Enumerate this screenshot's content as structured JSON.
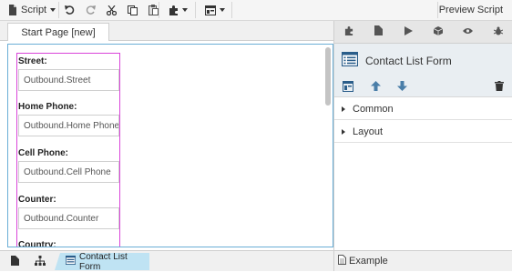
{
  "toolbar": {
    "script_label": "Script",
    "preview_label": "Preview Script"
  },
  "tabs": [
    {
      "label": "Start Page [new]"
    }
  ],
  "form": {
    "fields": [
      {
        "label": "Street:",
        "value": "Outbound.Street"
      },
      {
        "label": "Home Phone:",
        "value": "Outbound.Home Phone"
      },
      {
        "label": "Cell Phone:",
        "value": "Outbound.Cell Phone"
      },
      {
        "label": "Counter:",
        "value": "Outbound.Counter"
      },
      {
        "label": "Country:",
        "value": ""
      }
    ]
  },
  "right_panel": {
    "title": "Contact List Form",
    "sections": [
      {
        "label": "Common"
      },
      {
        "label": "Layout"
      }
    ]
  },
  "breadcrumb": {
    "current": "Contact List Form"
  },
  "bottom_right": {
    "label": "Example"
  },
  "colors": {
    "canvas_border": "#6aaed6",
    "form_outline": "#d944d9",
    "breadcrumb_bg": "#bfe3f3",
    "accent_blue": "#2a5d8a",
    "panel_header_bg": "#e9eef2"
  },
  "icons": {
    "toolbar": [
      "script-icon",
      "undo-icon",
      "redo-icon",
      "cut-icon",
      "copy-icon",
      "paste-icon",
      "puzzle-icon",
      "layout-icon"
    ],
    "right_panel_tabs": [
      "puzzle-icon",
      "page-icon",
      "play-icon",
      "cube-icon",
      "eye-icon",
      "bug-icon"
    ],
    "right_panel_actions": [
      "form-icon",
      "arrow-up-icon",
      "arrow-down-icon",
      "trash-icon"
    ]
  }
}
